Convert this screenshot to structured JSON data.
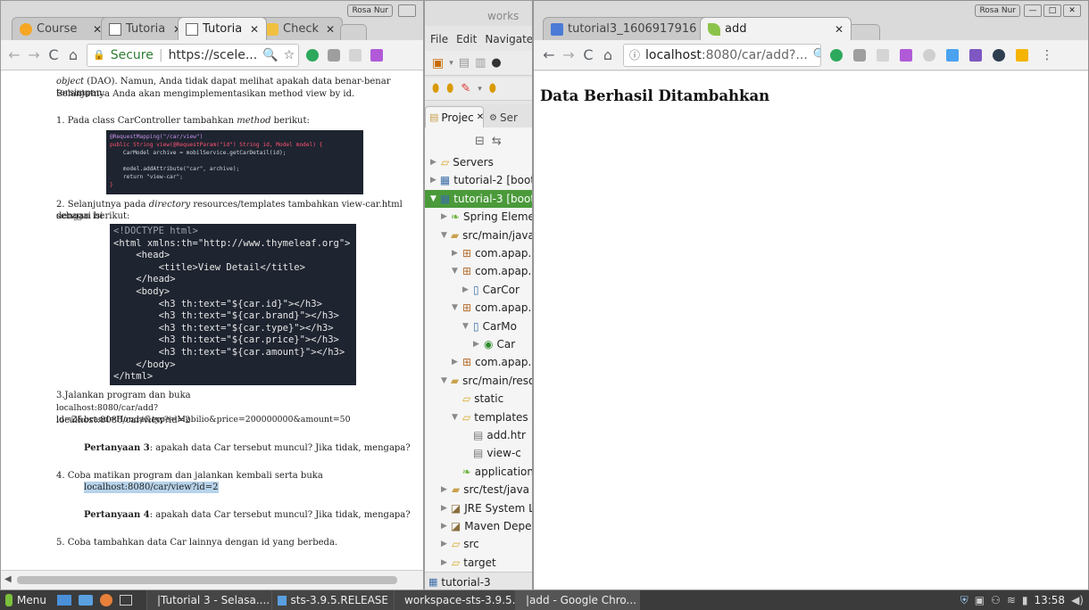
{
  "left_browser": {
    "user_badge": "Rosa Nur",
    "tabs": [
      {
        "label": "Course",
        "icon": "moodle-icon"
      },
      {
        "label": "Tutoria",
        "icon": "document-icon"
      },
      {
        "label": "Tutoria",
        "icon": "document-icon"
      },
      {
        "label": "Check",
        "icon": "check-icon"
      }
    ],
    "address": {
      "secure_label": "Secure",
      "url": "https://scele..."
    },
    "document": {
      "intro_line1_italic": "object",
      "intro_line1_rest": " (DAO). Namun, Anda tidak dapat melihat apakah data benar-benar tersimpan.",
      "intro_line2": "Selanjutnya Anda akan mengimplementasikan method view by id.",
      "step1_prefix": "1. Pada class CarController tambahkan ",
      "step1_italic": "method",
      "step1_suffix": " berikut:",
      "code1": [
        "@RequestMapping(\"/car/view\")",
        "public String view(@RequestParam(\"id\") String id, Model model) {",
        "    CarModel archive = mobilService.getCarDetail(id);",
        "",
        "    model.addAttribute(\"car\", archive);",
        "    return \"view-car\";",
        "}"
      ],
      "step2_prefix": "2. Selanjutnya pada ",
      "step2_italic": "directory",
      "step2_suffix": " resources/templates tambahkan view-car.html dengan isi",
      "step2_line2": "sebagai berikut:",
      "code2": [
        "<!DOCTYPE html>",
        "<html xmlns:th=\"http://www.thymeleaf.org\">",
        "    <head>",
        "        <title>View Detail</title>",
        "    </head>",
        "    <body>",
        "        <h3 th:text=\"${car.id}\"></h3>",
        "        <h3 th:text=\"${car.brand}\"></h3>",
        "        <h3 th:text=\"${car.type}\"></h3>",
        "        <h3 th:text=\"${car.price}\"></h3>",
        "        <h3 th:text=\"${car.amount}\"></h3>",
        "    </body>",
        "</html>"
      ],
      "step3_line1": "3.Jalankan program dan buka",
      "step3_line2": "localhost:8080/car/add?id=2&brand=Honda&type=Mobilio&price=200000000&amount=50",
      "step3_line3": "localhost:8080/car/view?id=2",
      "q3_bold": "Pertanyaan 3",
      "q3_rest": ": apakah data Car tersebut muncul? Jika tidak, mengapa?",
      "step4_line1": "4. Coba matikan program dan jalankan kembali serta buka",
      "step4_link": "localhost:8080/car/view?id=2",
      "q4_bold": "Pertanyaan 4",
      "q4_rest": ": apakah data Car tersebut muncul? Jika tidak, mengapa?",
      "step5": "5. Coba tambahkan data Car lainnya dengan id yang berbeda."
    }
  },
  "eclipse": {
    "title": "works",
    "menu": [
      "File",
      "Edit",
      "Navigate"
    ],
    "panel_tabs": [
      "Projec",
      "Ser"
    ],
    "tree": [
      {
        "label": "Servers",
        "indent": 0,
        "arrow": "▶",
        "icon": "folder-icon"
      },
      {
        "label": "tutorial-2 [boot] [",
        "indent": 0,
        "arrow": "▶",
        "icon": "project-icon"
      },
      {
        "label": "tutorial-3 [boot] [",
        "indent": 0,
        "arrow": "▼",
        "icon": "project-icon",
        "selected": true
      },
      {
        "label": "Spring Eleme",
        "indent": 1,
        "arrow": "▶",
        "icon": "spring-leaf-icon"
      },
      {
        "label": "src/main/java",
        "indent": 1,
        "arrow": "▼",
        "icon": "source-folder-icon"
      },
      {
        "label": "com.apap.",
        "indent": 2,
        "arrow": "▶",
        "icon": "package-icon"
      },
      {
        "label": "com.apap.",
        "indent": 2,
        "arrow": "▼",
        "icon": "package-icon"
      },
      {
        "label": "CarCor",
        "indent": 3,
        "arrow": "▶",
        "icon": "java-file-icon"
      },
      {
        "label": "com.apap.",
        "indent": 2,
        "arrow": "▼",
        "icon": "package-icon"
      },
      {
        "label": "CarMo",
        "indent": 3,
        "arrow": "▼",
        "icon": "java-file-icon"
      },
      {
        "label": "Car",
        "indent": 4,
        "arrow": "▶",
        "icon": "class-icon"
      },
      {
        "label": "com.apap.",
        "indent": 2,
        "arrow": "▶",
        "icon": "package-icon"
      },
      {
        "label": "src/main/reso",
        "indent": 1,
        "arrow": "▼",
        "icon": "source-folder-icon"
      },
      {
        "label": "static",
        "indent": 2,
        "arrow": "",
        "icon": "folder-icon"
      },
      {
        "label": "templates",
        "indent": 2,
        "arrow": "▼",
        "icon": "folder-icon"
      },
      {
        "label": "add.htr",
        "indent": 3,
        "arrow": "",
        "icon": "html-file-icon"
      },
      {
        "label": "view-c",
        "indent": 3,
        "arrow": "",
        "icon": "html-file-icon"
      },
      {
        "label": "application",
        "indent": 2,
        "arrow": "",
        "icon": "spring-leaf-icon"
      },
      {
        "label": "src/test/java",
        "indent": 1,
        "arrow": "▶",
        "icon": "source-folder-icon"
      },
      {
        "label": "JRE System Li",
        "indent": 1,
        "arrow": "▶",
        "icon": "library-icon"
      },
      {
        "label": "Maven Deper",
        "indent": 1,
        "arrow": "▶",
        "icon": "library-icon"
      },
      {
        "label": "src",
        "indent": 1,
        "arrow": "▶",
        "icon": "folder-icon"
      },
      {
        "label": "target",
        "indent": 1,
        "arrow": "▶",
        "icon": "folder-icon"
      }
    ],
    "status": "tutorial-3"
  },
  "right_browser": {
    "user_badge": "Rosa Nur",
    "tabs": [
      {
        "label": "tutorial3_1606917916 -",
        "icon": "document-icon"
      },
      {
        "label": "add",
        "icon": "leaf-icon"
      }
    ],
    "address": {
      "host": "localhost",
      "path": ":8080/car/add?..."
    },
    "page_heading": "Data Berhasil Ditambahkan"
  },
  "taskbar": {
    "menu_label": "Menu",
    "windows": [
      {
        "label": "|Tutorial 3 - Selasa....",
        "icon": "chrome-icon"
      },
      {
        "label": "sts-3.9.5.RELEASE",
        "icon": "folder-icon"
      },
      {
        "label": "workspace-sts-3.9.5....",
        "icon": "spring-icon"
      },
      {
        "label": "|add - Google Chro...",
        "icon": "chrome-icon"
      }
    ],
    "clock": "13:58"
  },
  "colors": {
    "code_bg": "#1e2430",
    "selected_tree": "#4a9a3a",
    "highlight": "#b7d3ea",
    "taskbar": "#3b3b3b"
  }
}
